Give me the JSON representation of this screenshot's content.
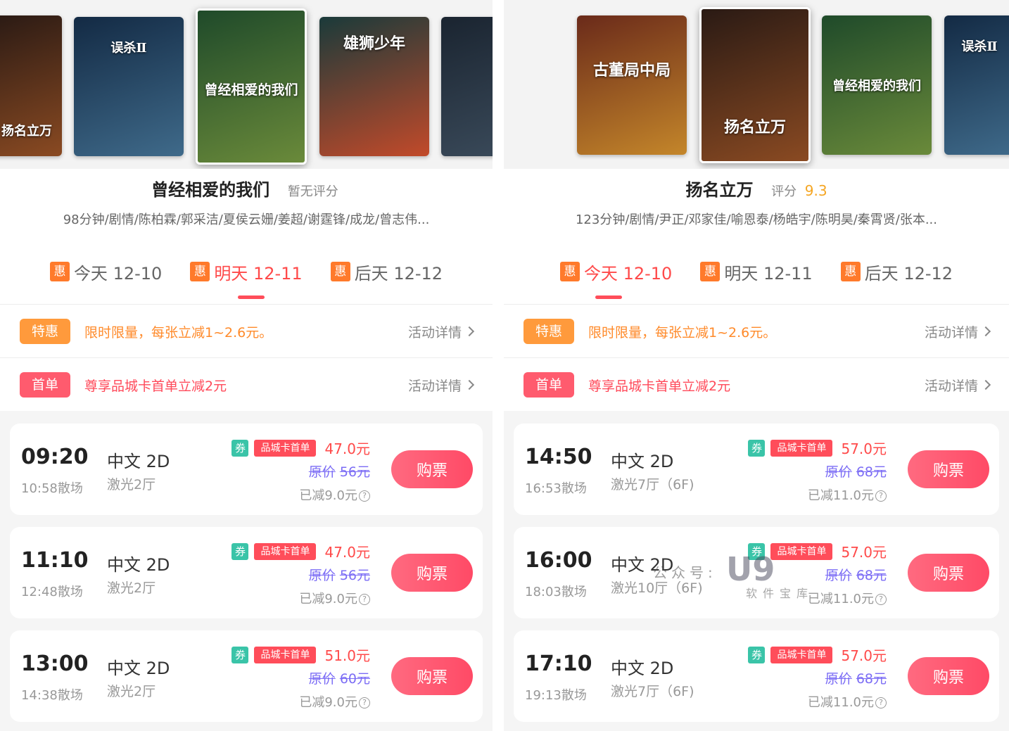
{
  "left": {
    "posters": [
      {
        "title": "扬名立万",
        "colors": [
          "#2a1a14",
          "#8a4a22"
        ],
        "selected": false
      },
      {
        "title": "误杀Ⅱ",
        "colors": [
          "#132a44",
          "#3f6a8a"
        ],
        "selected": false
      },
      {
        "title": "曾经相爱的我们",
        "colors": [
          "#1f4a2a",
          "#6a8a3a"
        ],
        "selected": true
      },
      {
        "title": "雄狮少年",
        "colors": [
          "#1a3a3a",
          "#c24a2a"
        ],
        "selected": false
      },
      {
        "title": "",
        "colors": [
          "#1a2430",
          "#3a4a5a"
        ],
        "selected": false
      }
    ],
    "movie": {
      "title": "曾经相爱的我们",
      "rating_label": "暂无评分",
      "rating_value": "",
      "meta": "98分钟/剧情/陈柏霖/郭采洁/夏侯云姗/姜超/谢霆锋/成龙/曾志伟..."
    },
    "dates": [
      {
        "badge": "惠",
        "label": "今天 12-10",
        "active": false
      },
      {
        "badge": "惠",
        "label": "明天 12-11",
        "active": true
      },
      {
        "badge": "惠",
        "label": "后天 12-12",
        "active": false
      }
    ],
    "promos": [
      {
        "badge": "特惠",
        "text": "限时限量，每张立减1~2.6元。",
        "link": "活动详情"
      },
      {
        "badge": "首单",
        "text": "尊享品城卡首单立减2元",
        "link": "活动详情"
      }
    ],
    "showtimes": [
      {
        "time": "09:20",
        "end": "10:58散场",
        "lang": "中文 2D",
        "hall": "激光2厅",
        "quan": "券",
        "card_tag": "品城卡首单",
        "price": "47.0元",
        "orig_label": "原价",
        "orig": "56元",
        "saved": "已减9.0元",
        "buy": "购票"
      },
      {
        "time": "11:10",
        "end": "12:48散场",
        "lang": "中文 2D",
        "hall": "激光2厅",
        "quan": "券",
        "card_tag": "品城卡首单",
        "price": "47.0元",
        "orig_label": "原价",
        "orig": "56元",
        "saved": "已减9.0元",
        "buy": "购票"
      },
      {
        "time": "13:00",
        "end": "14:38散场",
        "lang": "中文 2D",
        "hall": "激光2厅",
        "quan": "券",
        "card_tag": "品城卡首单",
        "price": "51.0元",
        "orig_label": "原价",
        "orig": "60元",
        "saved": "已减9.0元",
        "buy": "购票"
      }
    ]
  },
  "right": {
    "posters": [
      {
        "title": "古董局中局",
        "colors": [
          "#6a2a1a",
          "#c4862a"
        ],
        "selected": false
      },
      {
        "title": "扬名立万",
        "colors": [
          "#2a1a14",
          "#8a4a22"
        ],
        "selected": true
      },
      {
        "title": "曾经相爱的我们",
        "colors": [
          "#1f4a2a",
          "#6a8a3a"
        ],
        "selected": false
      },
      {
        "title": "误杀Ⅱ",
        "colors": [
          "#132a44",
          "#3f6a8a"
        ],
        "selected": false
      }
    ],
    "movie": {
      "title": "扬名立万",
      "rating_label": "评分",
      "rating_value": "9.3",
      "meta": "123分钟/剧情/尹正/邓家佳/喻恩泰/杨皓宇/陈明昊/秦霄贤/张本..."
    },
    "dates": [
      {
        "badge": "惠",
        "label": "今天 12-10",
        "active": true
      },
      {
        "badge": "惠",
        "label": "明天 12-11",
        "active": false
      },
      {
        "badge": "惠",
        "label": "后天 12-12",
        "active": false
      }
    ],
    "promos": [
      {
        "badge": "特惠",
        "text": "限时限量，每张立减1~2.6元。",
        "link": "活动详情"
      },
      {
        "badge": "首单",
        "text": "尊享品城卡首单立减2元",
        "link": "活动详情"
      }
    ],
    "showtimes": [
      {
        "time": "14:50",
        "end": "16:53散场",
        "lang": "中文 2D",
        "hall": "激光7厅（6F)",
        "quan": "券",
        "card_tag": "品城卡首单",
        "price": "57.0元",
        "orig_label": "原价",
        "orig": "68元",
        "saved": "已减11.0元",
        "buy": "购票"
      },
      {
        "time": "16:00",
        "end": "18:03散场",
        "lang": "中文 2D",
        "hall": "激光10厅（6F)",
        "quan": "券",
        "card_tag": "品城卡首单",
        "price": "57.0元",
        "orig_label": "原价",
        "orig": "68元",
        "saved": "已减11.0元",
        "buy": "购票"
      },
      {
        "time": "17:10",
        "end": "19:13散场",
        "lang": "中文 2D",
        "hall": "激光7厅（6F)",
        "quan": "券",
        "card_tag": "品城卡首单",
        "price": "57.0元",
        "orig_label": "原价",
        "orig": "68元",
        "saved": "已减11.0元",
        "buy": "购票"
      }
    ]
  },
  "watermark": {
    "text": "公众号:",
    "logo": "U9",
    "sub": "软件宝库"
  },
  "colors": {
    "accent_red": "#ff4d5a",
    "accent_orange": "#ff7a2b",
    "rating": "#f5a623",
    "strike_price": "#7b6cf5",
    "coupon": "#3ac4a8"
  }
}
